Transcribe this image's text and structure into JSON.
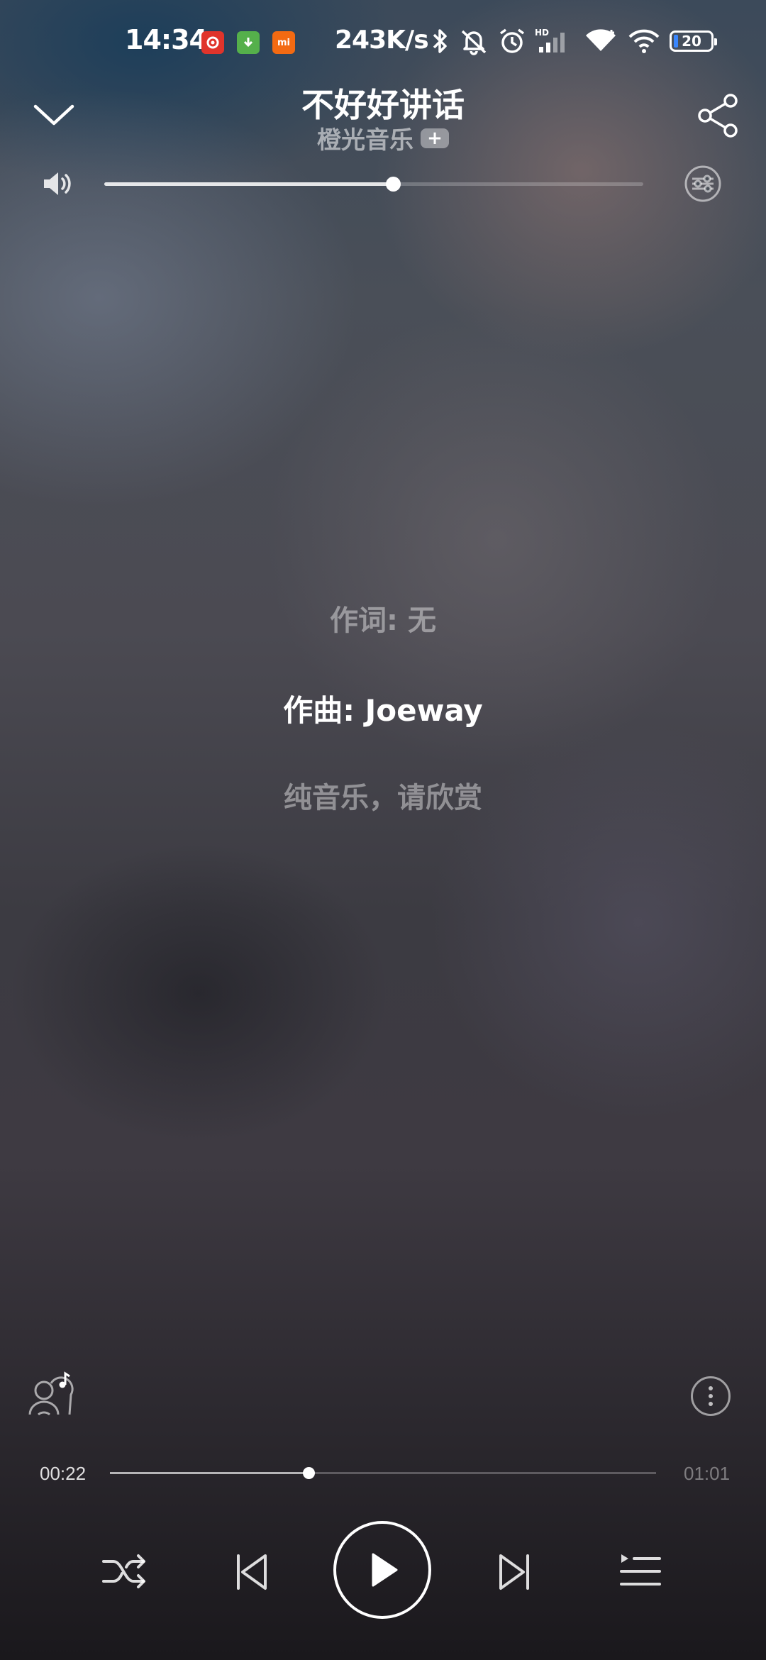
{
  "status_bar": {
    "time": "14:34",
    "network_speed": "243K/s",
    "battery_level": "20",
    "app_icons": [
      "netease-music-icon",
      "download-icon",
      "mi-icon"
    ],
    "status_icons": [
      "bluetooth-icon",
      "mute-icon",
      "alarm-icon",
      "hd-signal-icon",
      "wifi-icon",
      "wifi-icon",
      "battery-icon"
    ]
  },
  "header": {
    "song_title": "不好好讲话",
    "artist": "橙光音乐",
    "follow_label": "+"
  },
  "volume": {
    "level": 0.535
  },
  "lyrics": {
    "lines": [
      "作词: 无",
      "作曲: Joeway",
      "纯音乐，请欣赏"
    ],
    "active_index": 1
  },
  "playback": {
    "elapsed": "00:22",
    "total": "01:01",
    "progress": 0.363,
    "state": "paused"
  },
  "controls": {
    "icons": [
      "shuffle-icon",
      "previous-icon",
      "play-icon",
      "next-icon",
      "playlist-icon"
    ]
  },
  "colors": {
    "accent": "#ffffff",
    "battery_fill": "#3a87ff",
    "netease_red": "#e0342b"
  }
}
